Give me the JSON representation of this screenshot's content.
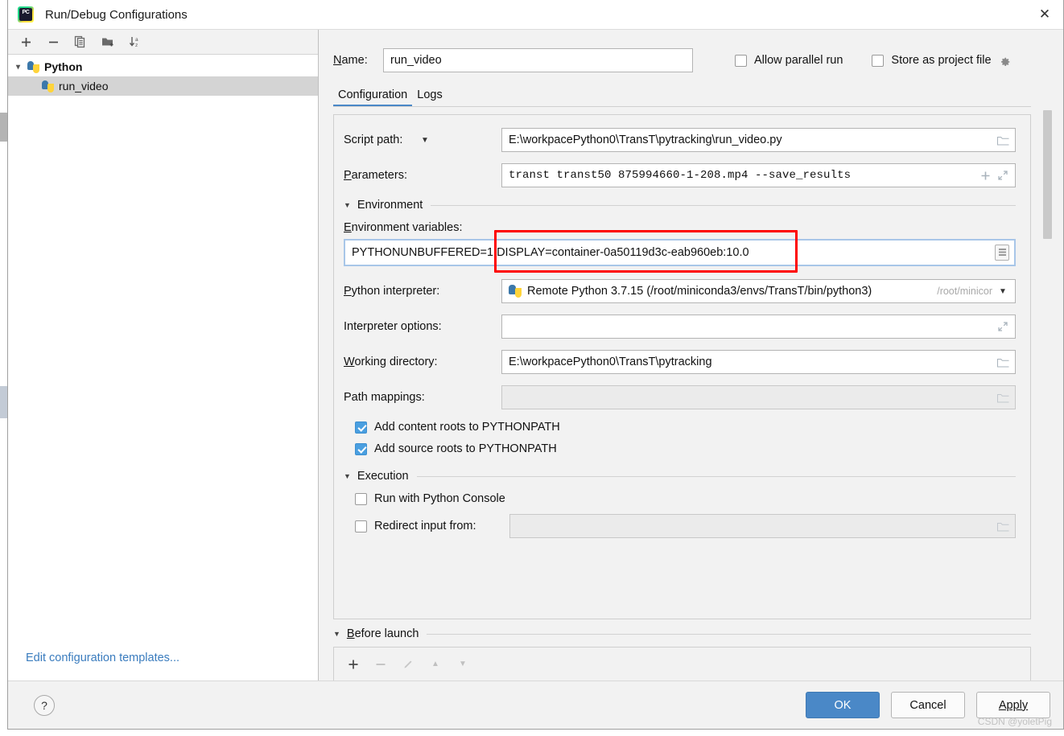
{
  "window": {
    "title": "Run/Debug Configurations",
    "app_icon": "pycharm-icon",
    "close_icon": "close-icon"
  },
  "sidebar": {
    "toolbar": [
      {
        "name": "add-configuration-button",
        "icon": "plus-icon",
        "glyph": "+"
      },
      {
        "name": "remove-configuration-button",
        "icon": "minus-icon",
        "glyph": "−"
      },
      {
        "name": "copy-configuration-button",
        "icon": "copy-icon",
        "glyph": "❐"
      },
      {
        "name": "new-folder-button",
        "icon": "folder-add-icon",
        "glyph": "▮"
      },
      {
        "name": "sort-configurations-button",
        "icon": "sort-az-icon",
        "glyph": "↓"
      }
    ],
    "tree": {
      "group_label": "Python",
      "group_expanded": true,
      "items": [
        {
          "label": "run_video",
          "selected": true
        }
      ]
    },
    "footer_link": "Edit configuration templates..."
  },
  "header": {
    "name_label": "Name:",
    "name_value": "run_video",
    "allow_parallel_run": {
      "label": "Allow parallel run",
      "checked": false
    },
    "store_as_project_file": {
      "label": "Store as project file",
      "checked": false
    },
    "gear_icon": "gear-icon"
  },
  "tabs": [
    {
      "label": "Configuration",
      "active": true
    },
    {
      "label": "Logs",
      "active": false
    }
  ],
  "configuration": {
    "script_path": {
      "label": "Script path:",
      "value": "E:\\workpacePython0\\TransT\\pytracking\\run_video.py",
      "browse_icon": "folder-icon",
      "dropdown_icon": "chevron-down-icon"
    },
    "parameters": {
      "label": "Parameters:",
      "value": "transt transt50 875994660-1-208.mp4 --save_results",
      "insert_icon": "plus-icon",
      "expand_icon": "expand-icon"
    },
    "environment_section": {
      "title": "Environment",
      "expanded": true
    },
    "environment_variables": {
      "label": "Environment variables:",
      "value": "PYTHONUNBUFFERED=1;DISPLAY=container-0a50119d3c-eab960eb:10.0",
      "edit_icon": "document-list-icon",
      "highlighted": true,
      "highlight_color": "#fe0000"
    },
    "python_interpreter": {
      "label": "Python interpreter:",
      "value": "Remote Python 3.7.15 (/root/miniconda3/envs/TransT/bin/python3)",
      "value_hint": "/root/minicor",
      "icon": "python-icon",
      "dropdown_icon": "chevron-down-icon"
    },
    "interpreter_options": {
      "label": "Interpreter options:",
      "value": "",
      "expand_icon": "expand-icon"
    },
    "working_directory": {
      "label": "Working directory:",
      "value": "E:\\workpacePython0\\TransT\\pytracking",
      "browse_icon": "folder-icon"
    },
    "path_mappings": {
      "label": "Path mappings:",
      "value": "",
      "disabled": true,
      "browse_icon": "folder-icon"
    },
    "checkboxes": [
      {
        "label": "Add content roots to PYTHONPATH",
        "checked": true
      },
      {
        "label": "Add source roots to PYTHONPATH",
        "checked": true
      }
    ],
    "execution_section": {
      "title": "Execution",
      "expanded": true
    },
    "run_with_python_console": {
      "label": "Run with Python Console",
      "checked": false
    },
    "redirect_input_from": {
      "label": "Redirect input from:",
      "checked": false,
      "value": "",
      "disabled": true,
      "browse_icon": "folder-icon"
    }
  },
  "before_launch": {
    "title": "Before launch",
    "expanded": true,
    "toolbar": [
      {
        "name": "add-task-button",
        "icon": "plus-icon",
        "glyph": "+",
        "enabled": true
      },
      {
        "name": "remove-task-button",
        "icon": "minus-icon",
        "glyph": "−",
        "enabled": false
      },
      {
        "name": "edit-task-button",
        "icon": "pencil-icon",
        "glyph": "╱",
        "enabled": false
      },
      {
        "name": "move-up-button",
        "icon": "arrow-up-icon",
        "glyph": "▲",
        "enabled": false
      },
      {
        "name": "move-down-button",
        "icon": "arrow-down-icon",
        "glyph": "▼",
        "enabled": false
      }
    ]
  },
  "footer": {
    "help_label": "?",
    "buttons": [
      {
        "label": "OK",
        "primary": true
      },
      {
        "label": "Cancel",
        "primary": false
      },
      {
        "label": "Apply",
        "primary": false,
        "mnemonic": true
      }
    ],
    "watermark": "CSDN @yoletPig"
  },
  "colors": {
    "accent": "#4a88c7",
    "checkbox_checked": "#4a9fe0",
    "link": "#3a7cbe",
    "highlight_red": "#fe0000"
  }
}
